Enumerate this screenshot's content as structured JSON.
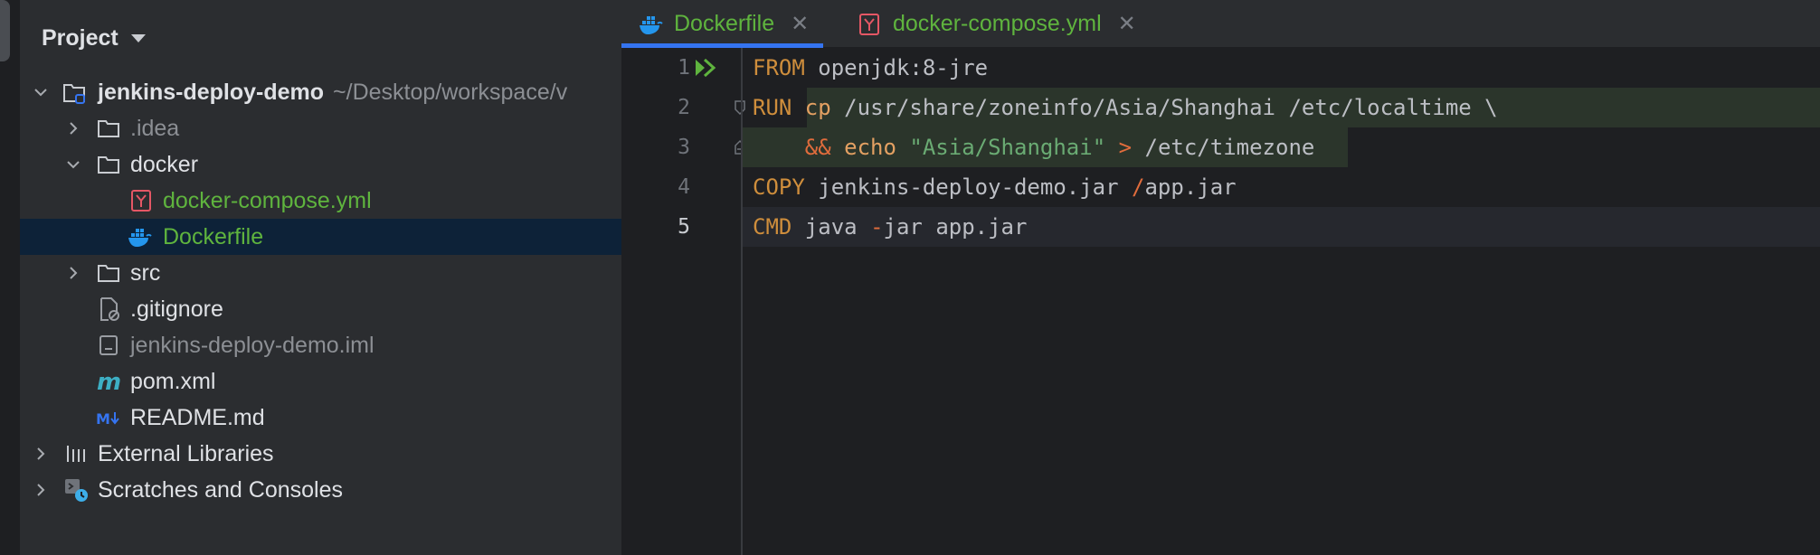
{
  "project_panel": {
    "title": "Project",
    "tree": [
      {
        "label": "jenkins-deploy-demo",
        "path": "~/Desktop/workspace/v",
        "type": "module"
      },
      {
        "label": ".idea",
        "type": "folder"
      },
      {
        "label": "docker",
        "type": "folder"
      },
      {
        "label": "docker-compose.yml",
        "type": "yaml"
      },
      {
        "label": "Dockerfile",
        "type": "docker"
      },
      {
        "label": "src",
        "type": "folder"
      },
      {
        "label": ".gitignore",
        "type": "gitignore"
      },
      {
        "label": "jenkins-deploy-demo.iml",
        "type": "iml"
      },
      {
        "label": "pom.xml",
        "type": "maven"
      },
      {
        "label": "README.md",
        "type": "markdown"
      },
      {
        "label": "External Libraries",
        "type": "libraries"
      },
      {
        "label": "Scratches and Consoles",
        "type": "scratches"
      }
    ]
  },
  "tabs": [
    {
      "label": "Dockerfile",
      "active": true
    },
    {
      "label": "docker-compose.yml",
      "active": false
    }
  ],
  "editor": {
    "line_numbers": [
      "1",
      "2",
      "3",
      "4",
      "5"
    ],
    "lines": [
      [
        {
          "t": "FROM",
          "c": "kw"
        },
        {
          "t": " openjdk:8-jre",
          "c": "tx"
        }
      ],
      [
        {
          "t": "RUN",
          "c": "kw"
        },
        {
          "t": " cp",
          "c": "kw2"
        },
        {
          "t": " /usr/share/zoneinfo/Asia/Shanghai /etc/localtime \\",
          "c": "tx"
        }
      ],
      [
        {
          "t": "    ",
          "c": "tx"
        },
        {
          "t": "&&",
          "c": "op"
        },
        {
          "t": " echo",
          "c": "kw2"
        },
        {
          "t": " ",
          "c": "tx"
        },
        {
          "t": "\"Asia/Shanghai\"",
          "c": "str"
        },
        {
          "t": " ",
          "c": "tx"
        },
        {
          "t": ">",
          "c": "op"
        },
        {
          "t": " /etc/timezone",
          "c": "tx"
        }
      ],
      [
        {
          "t": "COPY",
          "c": "kw"
        },
        {
          "t": " jenkins-deploy-demo.jar ",
          "c": "tx"
        },
        {
          "t": "/",
          "c": "op"
        },
        {
          "t": "app.jar",
          "c": "tx"
        }
      ],
      [
        {
          "t": "CMD",
          "c": "kw"
        },
        {
          "t": " java ",
          "c": "tx"
        },
        {
          "t": "-",
          "c": "op"
        },
        {
          "t": "jar app.jar",
          "c": "tx"
        }
      ]
    ]
  },
  "icons": {
    "project_caret": "chevron-down-icon",
    "run_gutter": "run-icon",
    "docker": "docker-whale-icon",
    "yaml": "yaml-icon"
  },
  "colors": {
    "accent": "#3574f0",
    "selection": "#0d2238",
    "vcs_added": "#5fb43e",
    "keyword": "#cf8e3c",
    "string": "#6aab73"
  }
}
